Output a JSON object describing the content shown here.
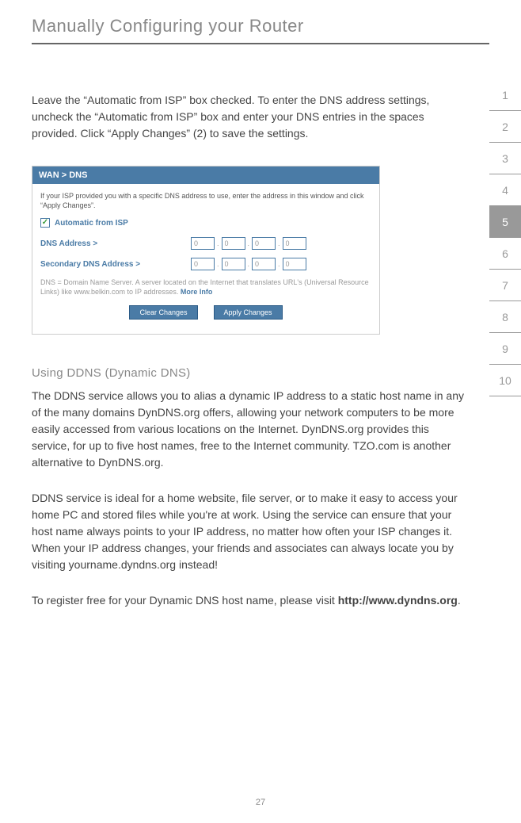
{
  "header": {
    "title": "Manually Configuring your Router"
  },
  "tabs": {
    "items": [
      "1",
      "2",
      "3",
      "4",
      "5",
      "6",
      "7",
      "8",
      "9",
      "10"
    ],
    "active_index": 4
  },
  "intro": "Leave the “Automatic from ISP” box checked. To enter the DNS address settings, uncheck the “Automatic from ISP” box and enter your DNS entries in the spaces provided. Click “Apply Changes” (2) to save the settings.",
  "panel": {
    "header": "WAN > DNS",
    "instruction": "If your ISP provided you with a specific DNS address to use, enter the address in this window and click “Apply Changes”.",
    "checkbox_label": "Automatic from ISP",
    "checkbox_checked": true,
    "dns_label": "DNS Address >",
    "secondary_label": "Secondary DNS Address >",
    "ip_default": "0",
    "footnote_prefix": "DNS = Domain Name Server. A server located on the Internet that translates URL's (Universal Resource Links) like www.belkin.com to IP addresses.",
    "footnote_link": "More Info",
    "clear_btn": "Clear Changes",
    "apply_btn": "Apply Changes"
  },
  "ddns": {
    "heading": "Using DDNS (Dynamic DNS)",
    "para1": "The DDNS service allows you to alias a dynamic IP address to a static host name in any of the many domains DynDNS.org offers, allowing your network computers to be more easily accessed from various locations on the Internet. DynDNS.org provides this service, for up to five host names, free to the Internet community. TZO.com is another alternative to DynDNS.org.",
    "para2": "DDNS service is ideal for a home website, file server, or to make it easy to access your home PC and stored files while you're at work. Using the service can ensure that your host name always points to your IP address, no matter how often your ISP changes it. When your IP address changes, your friends and associates can always locate you by visiting yourname.dyndns.org instead!",
    "para3_prefix": "To register free for your Dynamic DNS host name, please visit ",
    "para3_link": "http://www.dyndns.org",
    "para3_suffix": "."
  },
  "page_number": "27"
}
